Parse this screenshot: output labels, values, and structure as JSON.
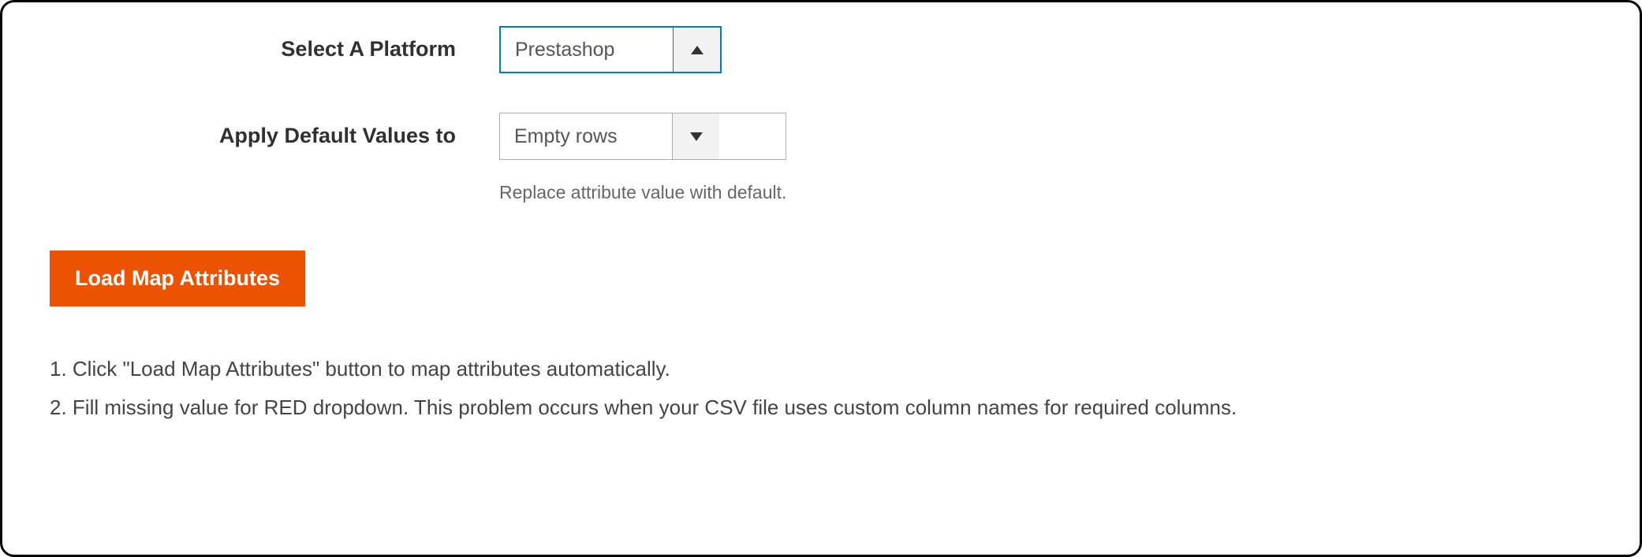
{
  "form": {
    "platform": {
      "label": "Select A Platform",
      "value": "Prestashop"
    },
    "defaults": {
      "label": "Apply Default Values to",
      "value": "Empty rows",
      "help": "Replace attribute value with default."
    }
  },
  "button": {
    "load_map": "Load Map Attributes"
  },
  "instructions": {
    "line1": "1. Click \"Load Map Attributes\" button to map attributes automatically.",
    "line2": "2. Fill missing value for RED dropdown. This problem occurs when your CSV file uses custom column names for required columns."
  }
}
